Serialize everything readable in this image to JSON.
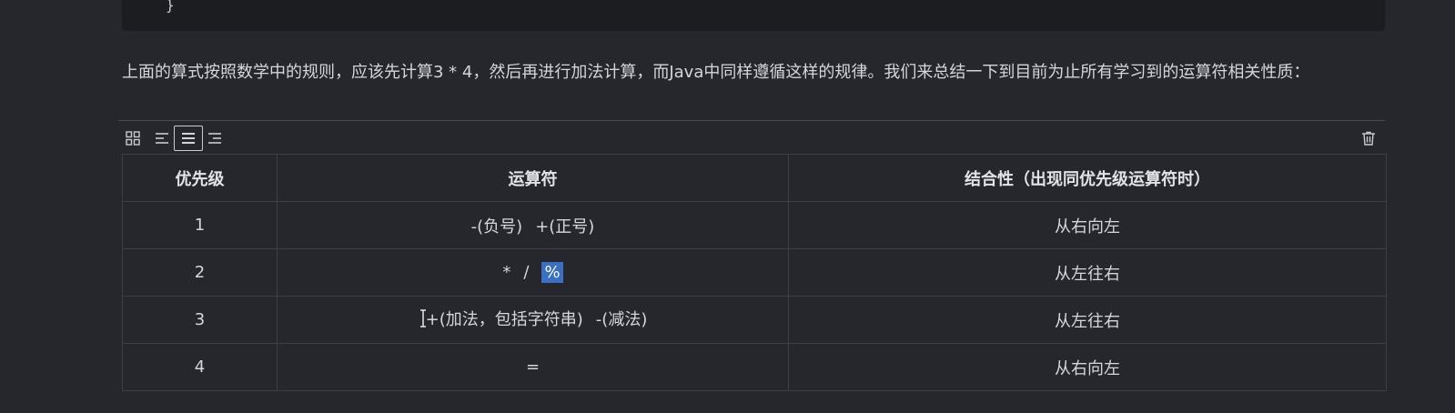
{
  "code_block": {
    "visible_line": "}"
  },
  "paragraph": {
    "text": "上面的算式按照数学中的规则，应该先计算3 * 4，然后再进行加法计算，而Java中同样遵循这样的规律。我们来总结一下到目前为止所有学习到的运算符相关性质："
  },
  "toolbar": {
    "icons": [
      "grid-icon",
      "align-left-icon",
      "align-center-icon",
      "align-right-icon",
      "trash-icon"
    ],
    "active": "align-center-icon"
  },
  "table": {
    "headers": [
      "优先级",
      "运算符",
      "结合性（出现同优先级运算符时）"
    ],
    "rows": [
      {
        "priority": "1",
        "op_a": "-(负号)",
        "op_b": "+(正号)",
        "assoc": "从右向左"
      },
      {
        "priority": "2",
        "op_a": "*",
        "op_b": "/",
        "op_c": "%",
        "assoc": "从左往右"
      },
      {
        "priority": "3",
        "op_a": "+(加法，包括字符串)",
        "op_b": "-(减法)",
        "assoc": "从左往右"
      },
      {
        "priority": "4",
        "op_a": "=",
        "assoc": "从右向左"
      }
    ]
  },
  "colors": {
    "background": "#25272c",
    "code_background": "#1c1d21",
    "selection": "#3a6fc4",
    "border": "#3d3f45"
  }
}
